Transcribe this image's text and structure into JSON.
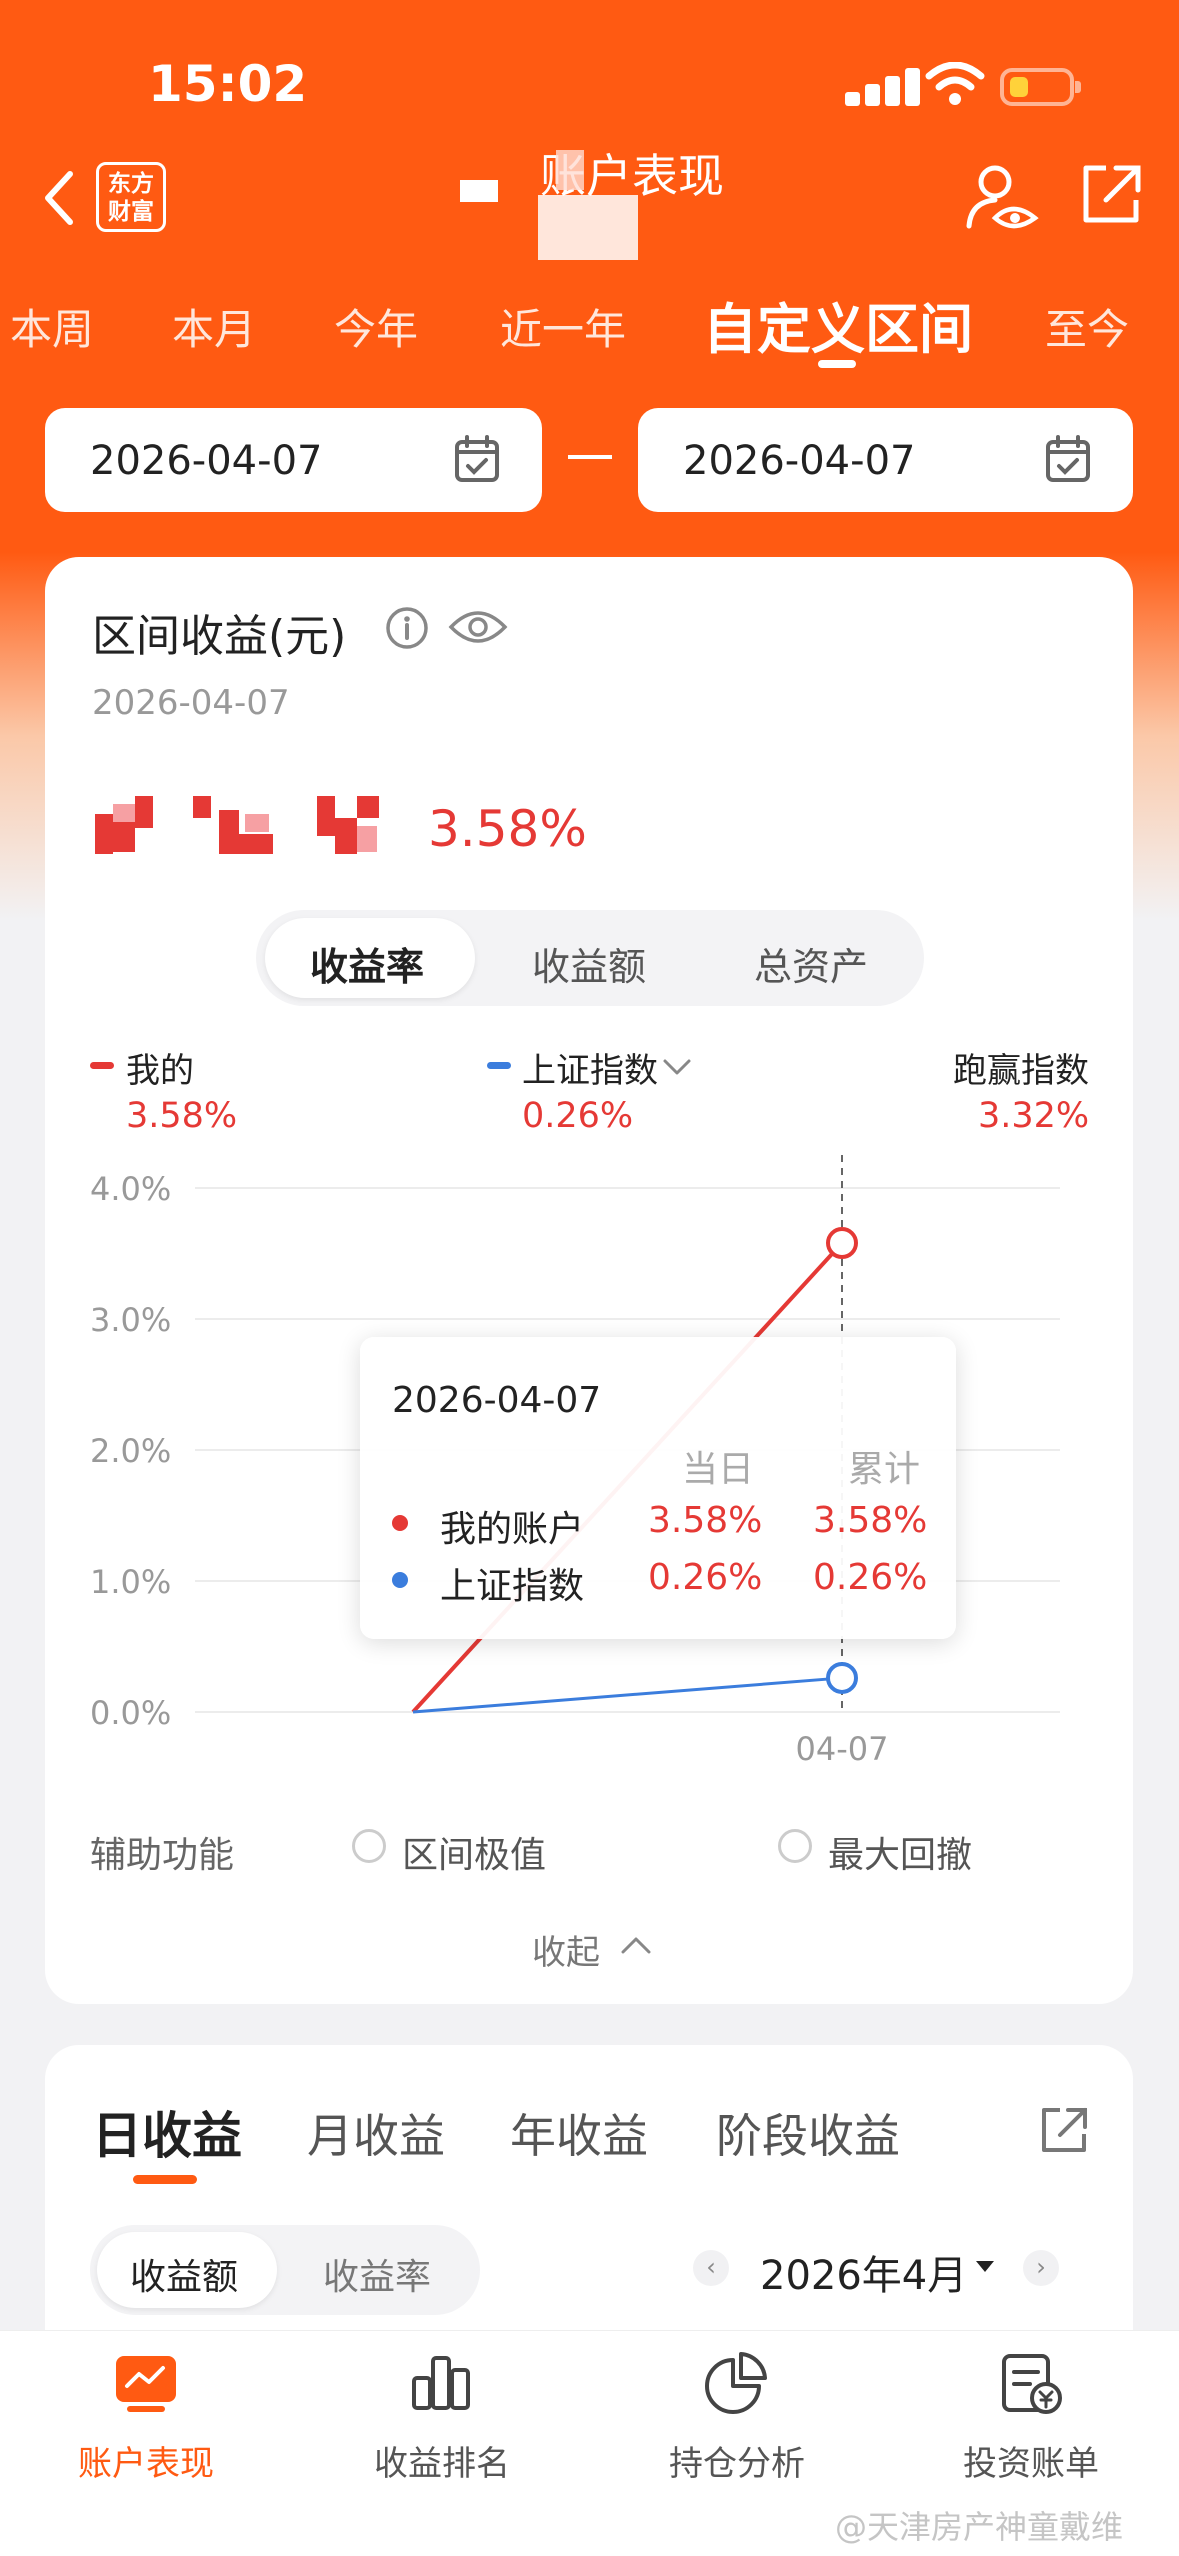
{
  "status_bar": {
    "time": "15:02"
  },
  "header": {
    "brand": [
      "东方",
      "财富"
    ],
    "title": "账户表现"
  },
  "period_tabs": [
    "本周",
    "本月",
    "今年",
    "近一年",
    "自定义区间",
    "至今"
  ],
  "date_range": {
    "start": "2026-04-07",
    "end": "2026-04-07"
  },
  "summary": {
    "title": "区间收益(元)",
    "date": "2026-04-07",
    "rate": "3.58%"
  },
  "metric_tabs": [
    "收益率",
    "收益额",
    "总资产"
  ],
  "legend": [
    {
      "name": "我的",
      "value": "3.58%",
      "color": "#e53935"
    },
    {
      "name": "上证指数",
      "value": "0.26%",
      "color": "#3b7ddd"
    },
    {
      "name": "跑赢指数",
      "value": "3.32%"
    }
  ],
  "chart_data": {
    "type": "line",
    "x": [
      "",
      "04-07"
    ],
    "x_tick_labels": [
      "04-07"
    ],
    "y_tick_labels": [
      "4.0%",
      "3.0%",
      "2.0%",
      "1.0%",
      "0.0%"
    ],
    "ylim": [
      0,
      4.0
    ],
    "series": [
      {
        "name": "我的",
        "values": [
          0,
          3.58
        ],
        "color": "#e53935"
      },
      {
        "name": "上证指数",
        "values": [
          0,
          0.26
        ],
        "color": "#3b7ddd"
      }
    ],
    "grid": true
  },
  "tooltip": {
    "date": "2026-04-07",
    "col_day": "当日",
    "col_total": "累计",
    "rows": [
      {
        "name": "我的账户",
        "day": "3.58%",
        "total": "3.58%",
        "color": "#e53935"
      },
      {
        "name": "上证指数",
        "day": "0.26%",
        "total": "0.26%",
        "color": "#3b7ddd"
      }
    ]
  },
  "aux": {
    "label": "辅助功能",
    "options": [
      "区间极值",
      "最大回撤"
    ]
  },
  "collapse_label": "收起",
  "returns_tabs": [
    "日收益",
    "月收益",
    "年收益",
    "阶段收益"
  ],
  "returns_toggle": [
    "收益额",
    "收益率"
  ],
  "month_picker": {
    "prev": "‹",
    "label": "2026年4月",
    "next": "›"
  },
  "bottom_nav": [
    "账户表现",
    "收益排名",
    "持仓分析",
    "投资账单"
  ],
  "watermark": "@天津房产神童戴维"
}
